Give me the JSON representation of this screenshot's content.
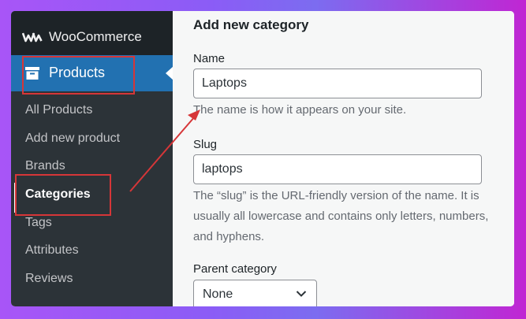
{
  "sidebar": {
    "brand": "WooCommerce",
    "menu": "Products",
    "items": [
      {
        "label": "All Products"
      },
      {
        "label": "Add new product"
      },
      {
        "label": "Brands"
      },
      {
        "label": "Categories",
        "current": true
      },
      {
        "label": "Tags"
      },
      {
        "label": "Attributes"
      },
      {
        "label": "Reviews"
      }
    ]
  },
  "form": {
    "title": "Add new category",
    "name_label": "Name",
    "name_value": "Laptops",
    "name_help": "The name is how it appears on your site.",
    "slug_label": "Slug",
    "slug_value": "laptops",
    "slug_help": "The “slug” is the URL-friendly version of the name. It is usually all lowercase and contains only letters, numbers, and hyphens.",
    "parent_label": "Parent category",
    "parent_value": "None"
  },
  "colors": {
    "highlight": "#d63638",
    "menu_active": "#2271b1",
    "sidebar": "#2c3338"
  }
}
